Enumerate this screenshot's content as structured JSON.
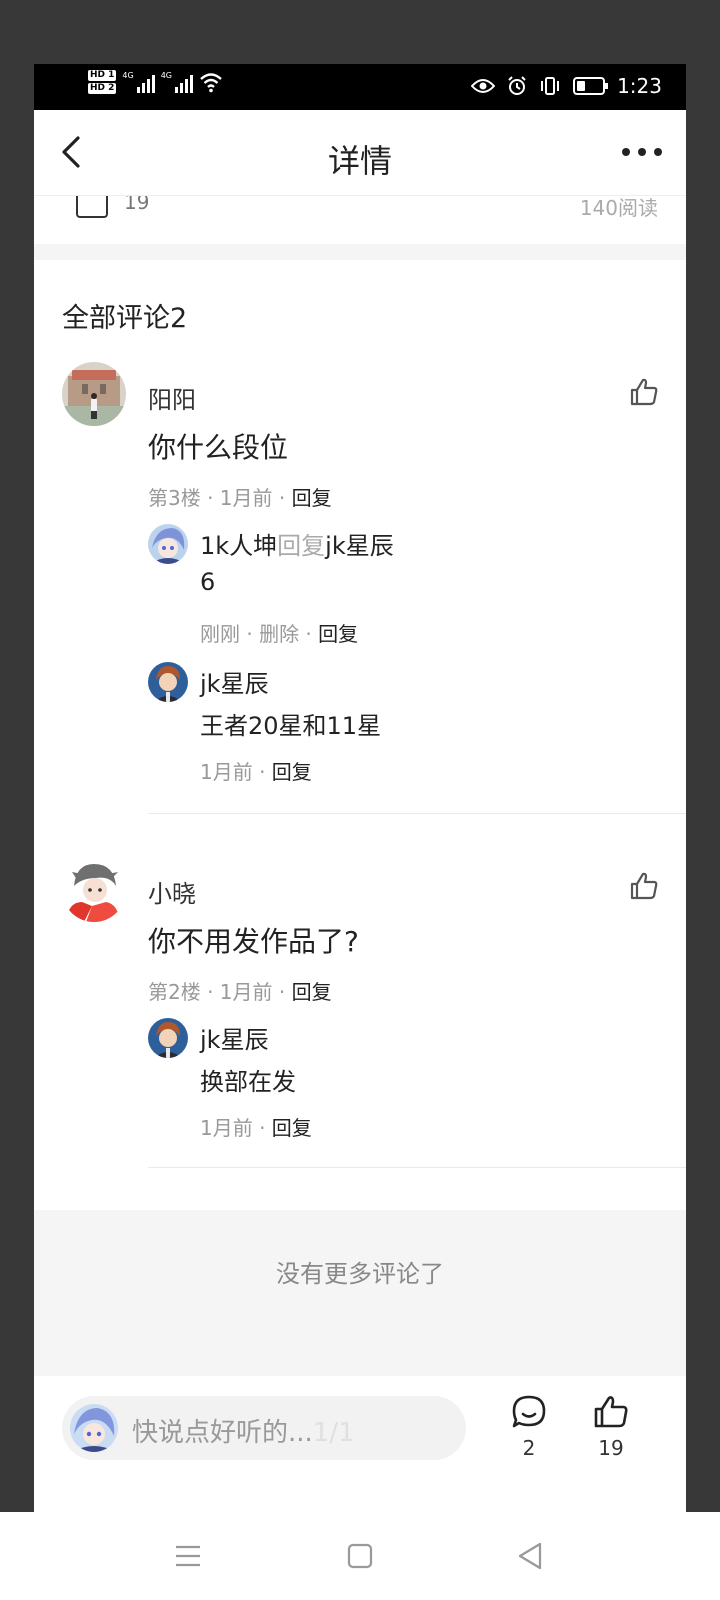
{
  "status_bar": {
    "hd1": "HD 1",
    "hd2": "HD 2",
    "net1": "4G",
    "net2": "4G",
    "time": "1:23",
    "battery_level": 0.3
  },
  "header": {
    "title": "详情"
  },
  "post_stats": {
    "like_count": "19",
    "read_count": "140阅读"
  },
  "comments": {
    "section_title": "全部评论2",
    "items": [
      {
        "name": "阳阳",
        "content": "你什么段位",
        "meta": "第3楼 · 1月前 · ",
        "reply_label": "回复",
        "replies": [
          {
            "author": "1k人坤",
            "reply_word": "回复",
            "target": "jk星辰",
            "text": "6",
            "meta_time": "刚刚 · 删除 · ",
            "reply_label": "回复"
          },
          {
            "author": "jk星辰",
            "text": "王者20星和11星",
            "meta_time": "1月前 · ",
            "reply_label": "回复"
          }
        ]
      },
      {
        "name": "小晓",
        "content": "你不用发作品了?",
        "meta": "第2楼 · 1月前 · ",
        "reply_label": "回复",
        "replies": [
          {
            "author": "jk星辰",
            "text": "换部在发",
            "meta_time": "1月前 · ",
            "reply_label": "回复"
          }
        ]
      }
    ],
    "no_more": "没有更多评论了"
  },
  "input_bar": {
    "placeholder": "快说点好听的...",
    "faint_text": "1/1",
    "comment_count": "2",
    "like_count": "19"
  },
  "colors": {
    "accent_text": "#222222",
    "muted_text": "#999999",
    "background": "#f5f5f5"
  }
}
